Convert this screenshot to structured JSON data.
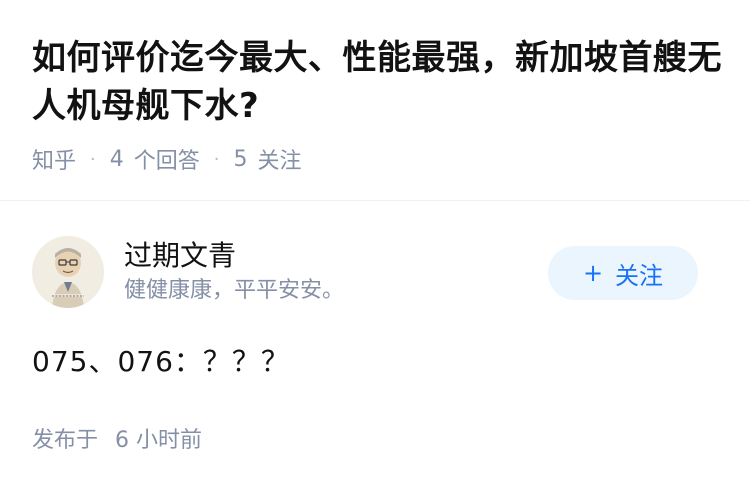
{
  "question": {
    "title": "如何评价迄今最大、性能最强，新加坡首艘无人机母舰下水?",
    "site": "知乎",
    "answer_count": "4",
    "answer_label": "个回答",
    "follow_count": "5",
    "follow_label": "关注"
  },
  "answer": {
    "author": {
      "name": "过期文青",
      "bio": "健健康康，平平安安。",
      "avatar_icon": "person-caricature-avatar"
    },
    "follow_button": {
      "plus": "+",
      "label": "关注"
    },
    "content": "075、076：？？？",
    "time_prefix": "发布于",
    "time_value": "6 小时前"
  },
  "colors": {
    "title": "#121212",
    "meta": "#8590a6",
    "accent": "#1772f6",
    "follow_bg": "#ebf5fd"
  }
}
